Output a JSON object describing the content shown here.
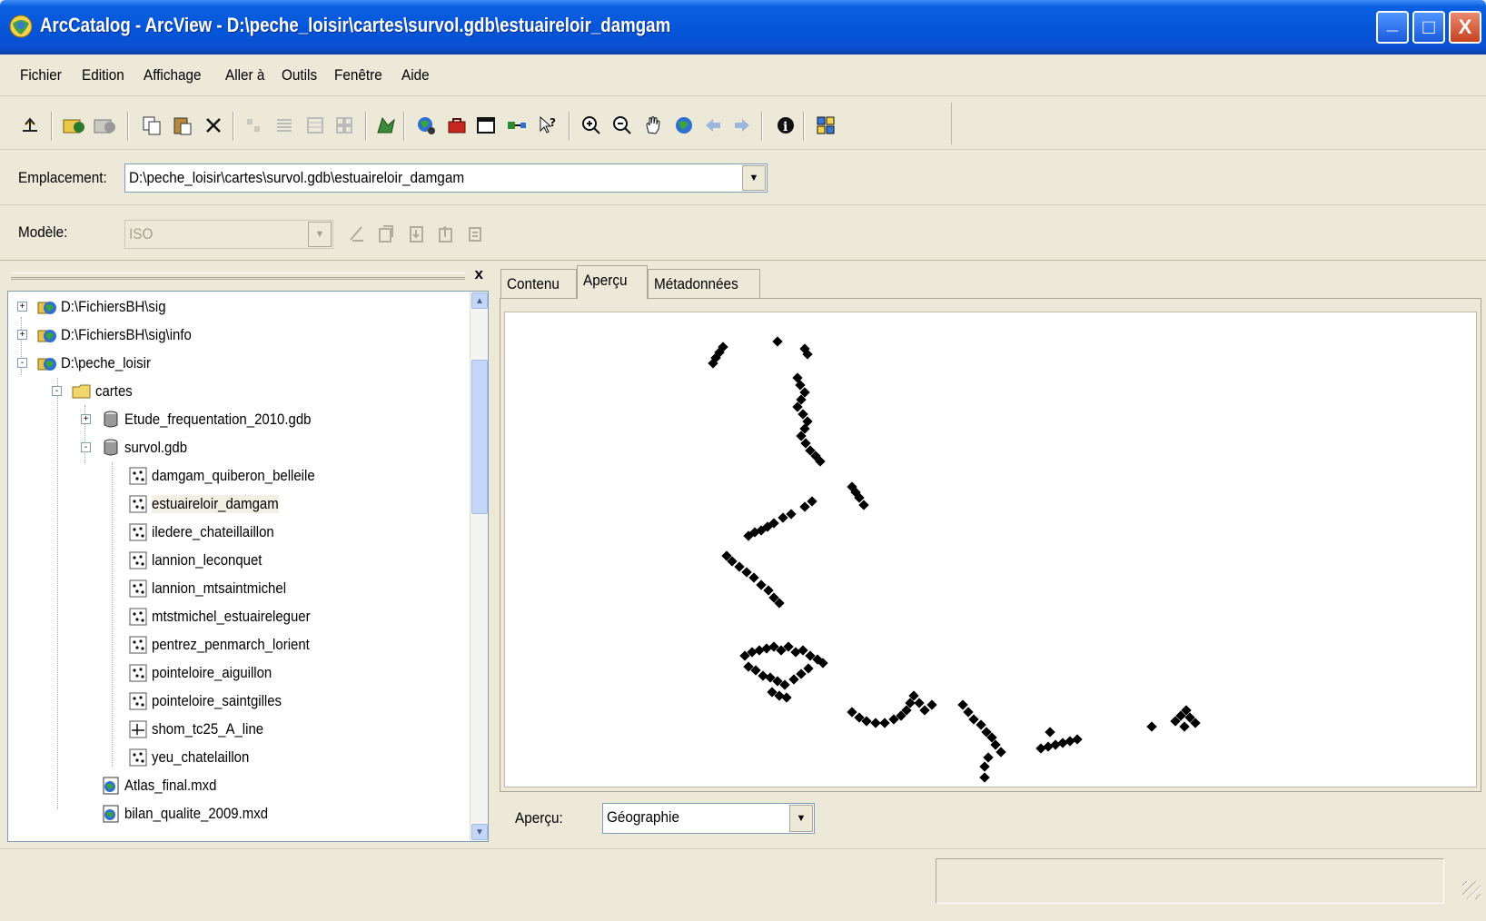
{
  "window": {
    "title": "ArcCatalog - ArcView - D:\\peche_loisir\\cartes\\survol.gdb\\estuaireloir_damgam",
    "controls": {
      "minimize": "_",
      "maximize": "□",
      "close": "X"
    }
  },
  "menu": [
    "Fichier",
    "Edition",
    "Affichage",
    "Aller à",
    "Outils",
    "Fenêtre",
    "Aide"
  ],
  "toolbar_icons": [
    "up-one-level-icon",
    "connect-folder-icon",
    "disconnect-folder-icon",
    "copy-icon",
    "paste-icon",
    "delete-icon",
    "large-icons-icon",
    "list-icon",
    "details-icon",
    "thumbnails-icon",
    "launch-arcmap-icon",
    "search-icon",
    "arctoolbox-icon",
    "command-line-icon",
    "model-builder-icon",
    "whats-this-icon",
    "zoom-in-icon",
    "zoom-out-icon",
    "pan-icon",
    "full-extent-icon",
    "back-icon",
    "forward-icon",
    "identify-icon",
    "create-thumbnail-icon"
  ],
  "location": {
    "label": "Emplacement:",
    "value": "D:\\peche_loisir\\cartes\\survol.gdb\\estuaireloir_damgam"
  },
  "metadata_toolbar": {
    "label": "Modèle:",
    "value": "ISO"
  },
  "tree": {
    "close_label": "x",
    "items": [
      {
        "label": "D:\\FichiersBH\\sig",
        "type": "folder-connection",
        "level": 0,
        "expander": "+"
      },
      {
        "label": "D:\\FichiersBH\\sig\\info",
        "type": "folder-connection",
        "level": 0,
        "expander": "+"
      },
      {
        "label": "D:\\peche_loisir",
        "type": "folder-connection",
        "level": 0,
        "expander": "-"
      },
      {
        "label": "cartes",
        "type": "folder",
        "level": 1,
        "expander": "-"
      },
      {
        "label": "Etude_frequentation_2010.gdb",
        "type": "geodatabase",
        "level": 2,
        "expander": "+"
      },
      {
        "label": "survol.gdb",
        "type": "geodatabase",
        "level": 2,
        "expander": "-"
      },
      {
        "label": "damgam_quiberon_belleile",
        "type": "point-feature-class",
        "level": 3
      },
      {
        "label": "estuaireloir_damgam",
        "type": "point-feature-class",
        "level": 3,
        "selected": true
      },
      {
        "label": "iledere_chateillaillon",
        "type": "point-feature-class",
        "level": 3
      },
      {
        "label": "lannion_leconquet",
        "type": "point-feature-class",
        "level": 3
      },
      {
        "label": "lannion_mtsaintmichel",
        "type": "point-feature-class",
        "level": 3
      },
      {
        "label": "mtstmichel_estuaireleguer",
        "type": "point-feature-class",
        "level": 3
      },
      {
        "label": "pentrez_penmarch_lorient",
        "type": "point-feature-class",
        "level": 3
      },
      {
        "label": "pointeloire_aiguillon",
        "type": "point-feature-class",
        "level": 3
      },
      {
        "label": "pointeloire_saintgilles",
        "type": "point-feature-class",
        "level": 3
      },
      {
        "label": "shom_tc25_A_line",
        "type": "line-feature-class",
        "level": 3
      },
      {
        "label": "yeu_chatelaillon",
        "type": "point-feature-class",
        "level": 3
      },
      {
        "label": "Atlas_final.mxd",
        "type": "map-document",
        "level": 2
      },
      {
        "label": "bilan_qualite_2009.mxd",
        "type": "map-document",
        "level": 2
      }
    ]
  },
  "tabs": [
    {
      "label": "Contenu",
      "active": false
    },
    {
      "label": "Aperçu",
      "active": true
    },
    {
      "label": "Métadonnées",
      "active": false
    }
  ],
  "preview": {
    "label": "Aperçu:",
    "mode": "Géographie",
    "symbol_color": "#000000"
  },
  "colors": {
    "titlebar": "#0654d8",
    "window_bg": "#ece9d8",
    "close_button": "#c8421e"
  }
}
